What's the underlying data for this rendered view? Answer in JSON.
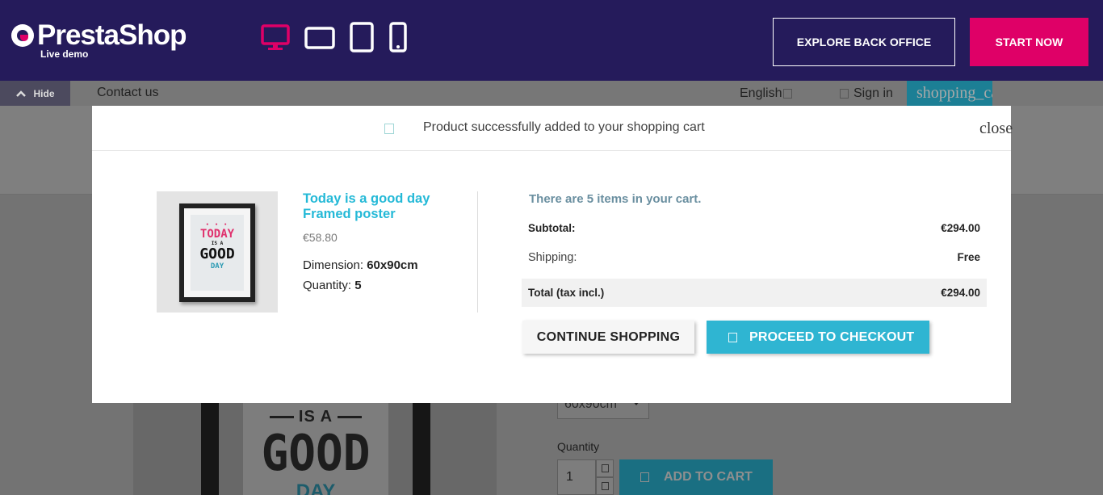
{
  "demo_bar": {
    "brand": "PrestaShop",
    "brand_sub": "Live demo",
    "devices": [
      "desktop-icon",
      "laptop-icon",
      "tablet-icon",
      "phone-icon"
    ],
    "active_device_color": "#df0067",
    "explore_label": "EXPLORE BACK OFFICE",
    "start_label": "START NOW",
    "background": "#251b5b"
  },
  "shop_header": {
    "hide_label": "Hide",
    "contact_label": "Contact us",
    "language": "English",
    "signin_label": "Sign in",
    "cart_label": "shopping_cart"
  },
  "product_page": {
    "poster_line1": "IS A",
    "poster_line2": "GOOD",
    "poster_line3": "DAY",
    "dimension_value": "60x90cm",
    "quantity_label": "Quantity",
    "quantity_value": "1",
    "add_to_cart_label": "ADD TO CART"
  },
  "modal": {
    "title": "Product successfully added to your shopping cart",
    "close_label": "close",
    "product": {
      "name": "Today is a good day Framed poster",
      "price": "€58.80",
      "dimension_label": "Dimension:",
      "dimension_value": "60x90cm",
      "quantity_label": "Quantity:",
      "quantity_value": "5",
      "poster_today": "TODAY",
      "poster_is_a": "IS A",
      "poster_good": "GOOD",
      "poster_day": "DAY"
    },
    "cart": {
      "count_text": "There are 5 items in your cart.",
      "subtotal_label": "Subtotal:",
      "subtotal_value": "€294.00",
      "shipping_label": "Shipping:",
      "shipping_value": "Free",
      "total_label": "Total (tax incl.)",
      "total_value": "€294.00"
    },
    "continue_label": "CONTINUE SHOPPING",
    "checkout_label": "PROCEED TO CHECKOUT",
    "accent_color": "#2fb5d2"
  }
}
